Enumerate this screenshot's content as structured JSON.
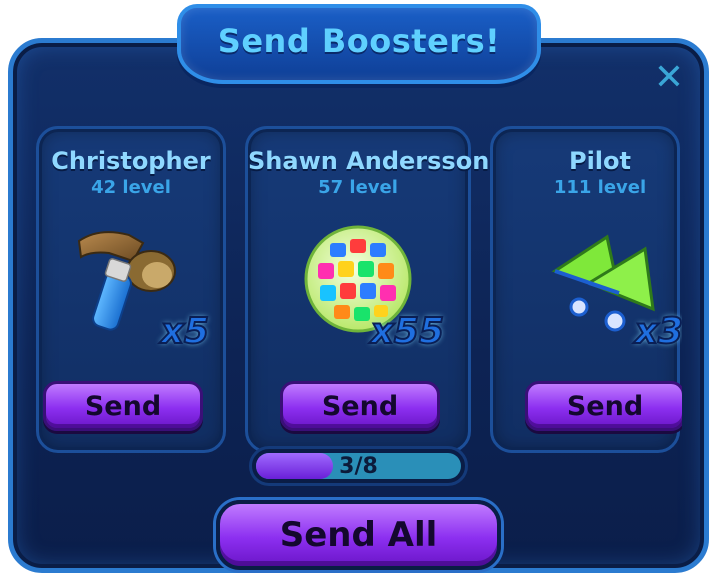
{
  "header": {
    "title": "Send Boosters!"
  },
  "close": {
    "icon": "close-icon"
  },
  "friends": [
    {
      "name": "Christopher",
      "level": "42 level",
      "booster": "hammer-icon",
      "count": "x5",
      "send_label": "Send"
    },
    {
      "name": "Shawn Andersson",
      "level": "57 level",
      "booster": "disco-ball-icon",
      "count": "x55",
      "send_label": "Send"
    },
    {
      "name": "Pilot",
      "level": "111 level",
      "booster": "paper-plane-icon",
      "count": "x3",
      "send_label": "Send"
    }
  ],
  "progress": {
    "text": "3/8",
    "current": 3,
    "total": 8
  },
  "footer": {
    "send_all_label": "Send All"
  },
  "colors": {
    "title_text": "#5fd0ff",
    "level_text": "#3aa5e8",
    "button_purple": "#8c2ff0",
    "panel_blue": "#12306a"
  }
}
